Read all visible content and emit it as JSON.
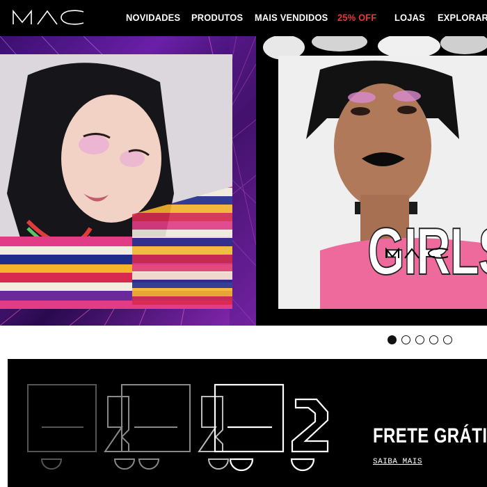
{
  "brand": {
    "logo_text": "MAC"
  },
  "nav": {
    "items": [
      {
        "label": "NOVIDADES",
        "color": "#ffffff"
      },
      {
        "label": "PRODUTOS",
        "color": "#ffffff"
      },
      {
        "label": "MAIS VENDIDOS",
        "color": "#ffffff"
      },
      {
        "label": "25% OFF",
        "color": "#e8383d"
      },
      {
        "label": "LOJAS",
        "color": "#ffffff"
      },
      {
        "label": "EXPLORAR",
        "color": "#ffffff"
      }
    ]
  },
  "hero": {
    "slides": [
      {
        "description_icon": "model-photo-striped-sweater"
      },
      {
        "description_icon": "model-photo-black-lips",
        "overlay_text": "GIRLS",
        "overlay_logo": "MAC"
      }
    ],
    "pagination": {
      "count": 5,
      "active_index": 0
    }
  },
  "shipping_banner": {
    "title": "FRETE GRÁTIS",
    "link_label": "SAIBA MAIS",
    "icon": "truck-icon"
  },
  "colors": {
    "header_bg": "#000000",
    "sale_accent": "#e8383d",
    "banner_bg": "#000000"
  }
}
